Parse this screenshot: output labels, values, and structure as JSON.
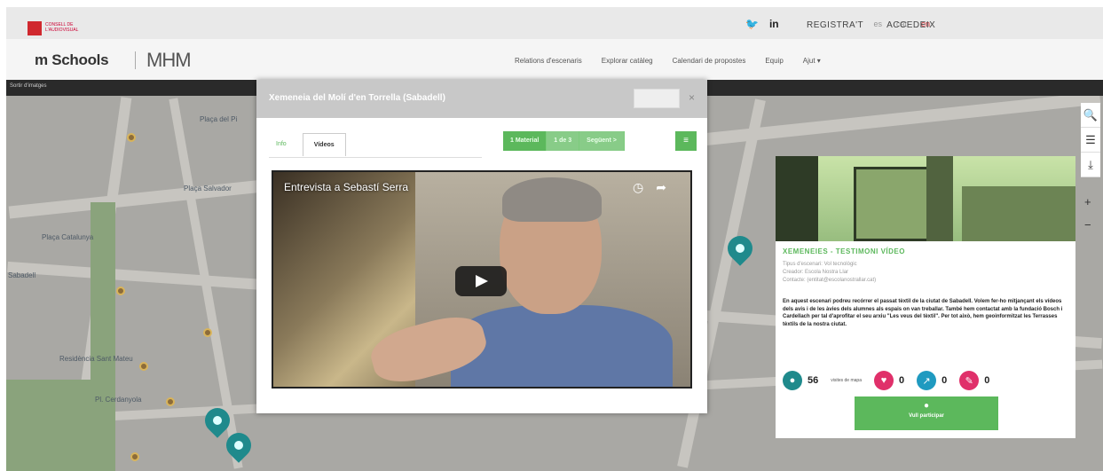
{
  "header": {
    "logo_text": "CONSELL\nDE L'AUDIOVISUAL",
    "lang_links": [
      "es",
      "cat",
      "en"
    ],
    "social": [
      "twitter-icon",
      "linkedin-icon"
    ],
    "register_label": "REGISTRA'T",
    "login_label": "ACCEDEIX"
  },
  "nav": {
    "brand": "m Schools",
    "brand2": "MHM",
    "links": [
      "Relations d'escenaris",
      "Explorar catàleg",
      "Calendari de propostes",
      "Equip",
      "Ajut ▾"
    ]
  },
  "map": {
    "darkbar_text": "Sortir d'imatges",
    "labels": [
      "Plaça del Pi",
      "Plaça Salvador",
      "Plaça Catalunya",
      "Sabadell",
      "Residència Sant Mateu",
      "Pl. Cerdanyola"
    ]
  },
  "modal": {
    "title": "Xemeneia del Molí d'en Torrella (Sabadell)",
    "tabs": [
      "Info",
      "Vídeos"
    ],
    "pager": [
      "1 Material",
      "1 de 3",
      "Següent >",
      "≡"
    ],
    "video": {
      "title": "Entrevista a Sebastí Serra",
      "icons": [
        "clock-icon",
        "share-icon"
      ]
    }
  },
  "card": {
    "title": "XEMENEIES - TESTIMONI VÍDEO",
    "meta_lines": [
      "Tipus d'escenari: Vol tecnològic",
      "Creador: Escola Nostra Llar",
      "Contacte: (entitat@escolanostrallar.cat)"
    ],
    "description": "En aquest escenari podreu recórrer el passat tèxtil de la ciutat de Sabadell. Volem fer-ho mitjançant els vídeos dels avis i de les àvies dels alumnes als espais on van treballar. També hem contactat amb la fundació Bosch i Cardellach per tal d'aprofitar el seu arxiu \"Les veus del tèxtil\". Per tot això, hem geoinformitzat les Terrasses tèxtils de la nostra ciutat.",
    "stats": {
      "views": "56",
      "views_label": "visites\nde mapa",
      "likes": "0",
      "shares": "0",
      "comments": "0"
    },
    "participate_label": "Vull participar"
  },
  "colors": {
    "accent": "#5cb85c",
    "pin": "#1f8a8c",
    "brand_red": "#d0282e"
  }
}
